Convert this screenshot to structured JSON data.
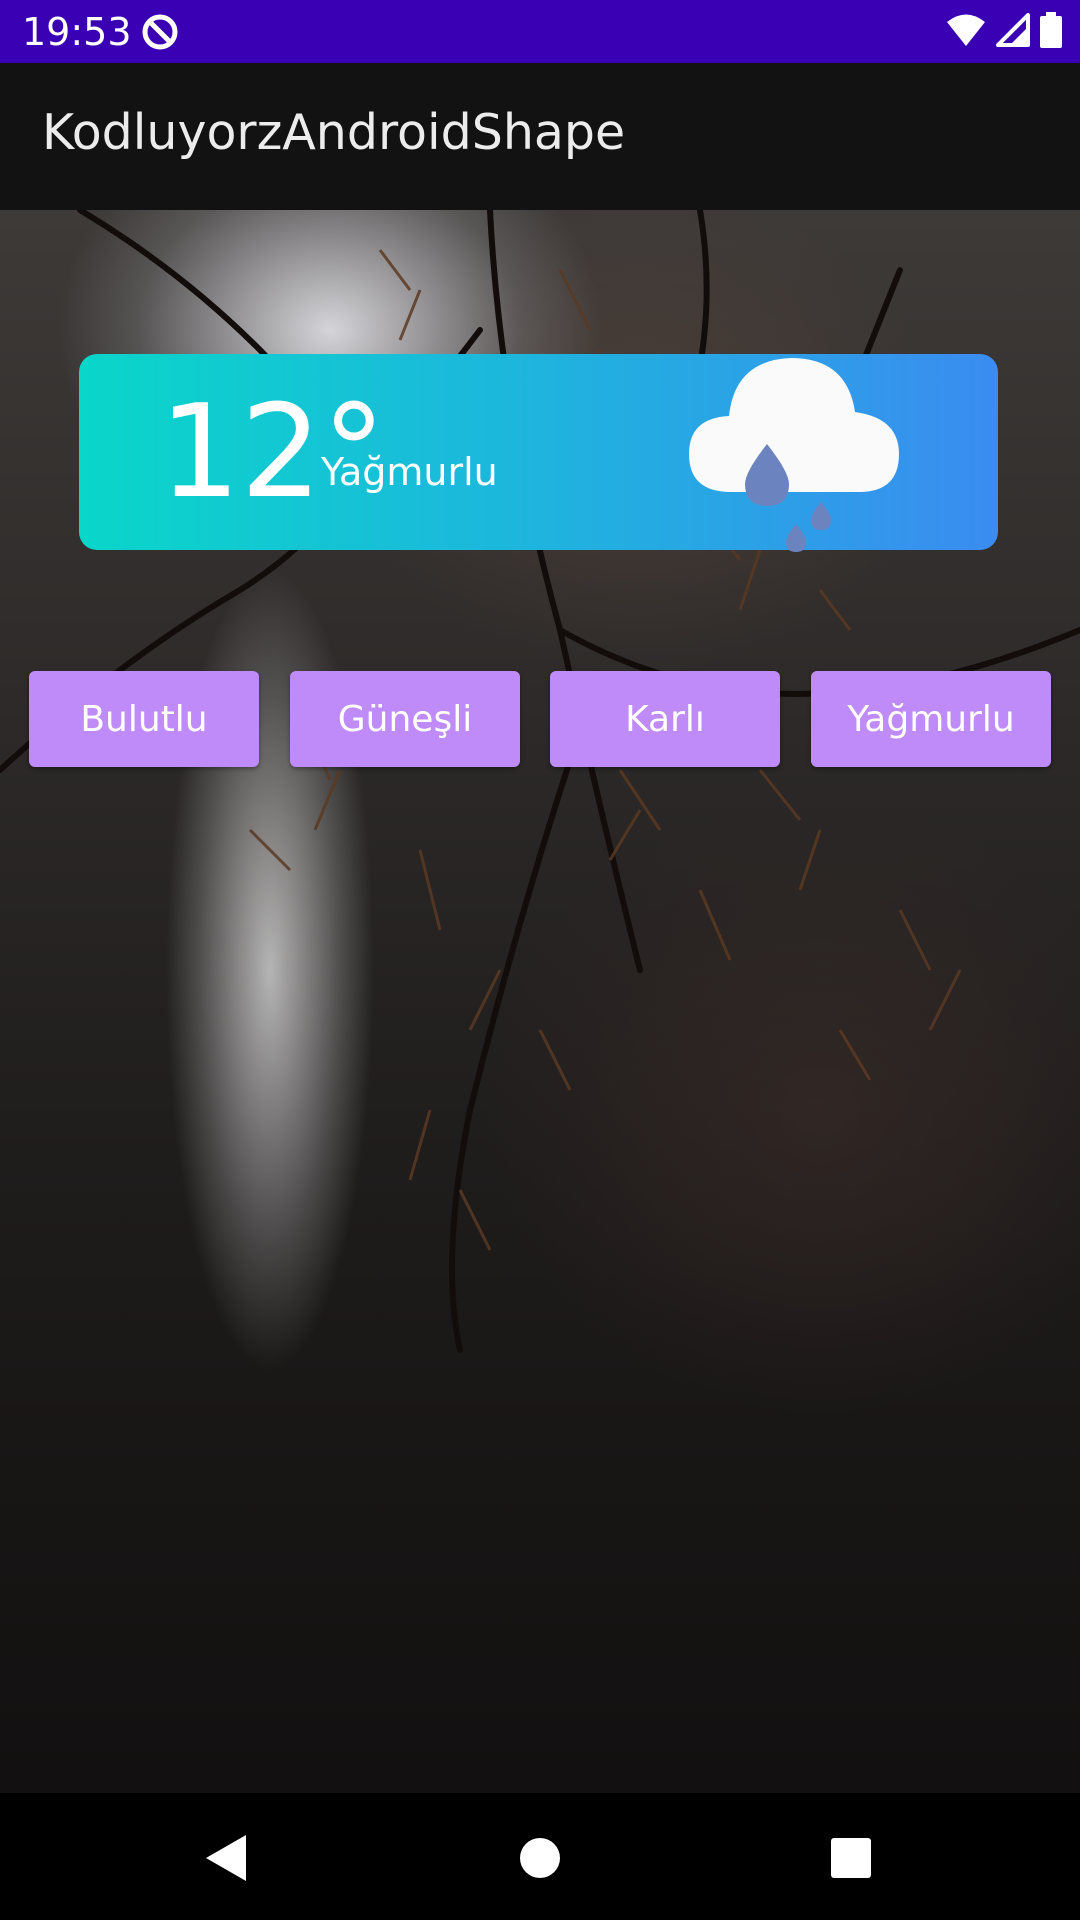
{
  "status_bar": {
    "time": "19:53",
    "color": "#3a00b4",
    "icons": [
      "app-notification-icon",
      "wifi-icon",
      "cellular-signal-icon",
      "battery-icon"
    ]
  },
  "app_bar": {
    "title": "KodluyorzAndroidShape"
  },
  "weather_card": {
    "temperature": "12°",
    "condition": "Yağmurlu",
    "icon": "rain-cloud-icon",
    "gradient": [
      "#0ad6c9",
      "#3a8cf0"
    ]
  },
  "buttons": [
    {
      "label": "Bulutlu"
    },
    {
      "label": "Güneşli"
    },
    {
      "label": "Karlı"
    },
    {
      "label": "Yağmurlu"
    }
  ],
  "button_color": "#bf8bf8",
  "nav_bar": {
    "icons": [
      "back-icon",
      "home-icon",
      "recents-icon"
    ]
  }
}
